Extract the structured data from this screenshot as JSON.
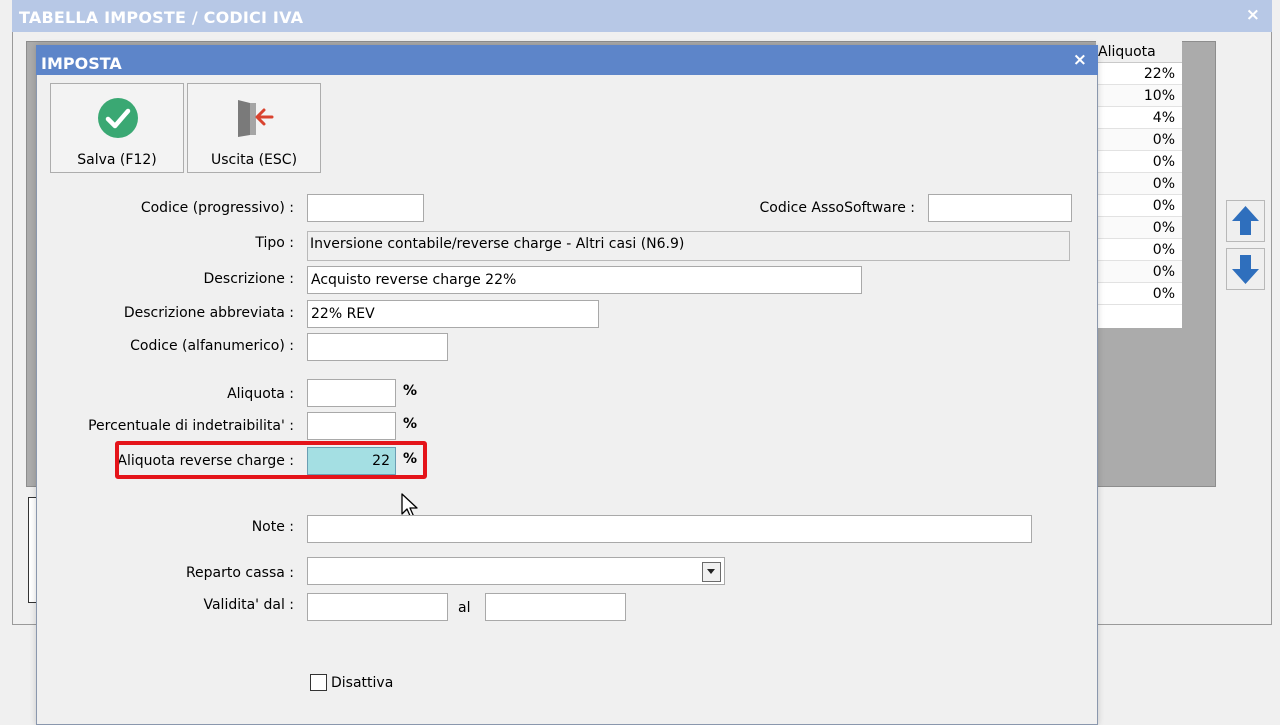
{
  "back_window": {
    "title": "TABELLA IMPOSTE / CODICI IVA",
    "close": "×",
    "grid": {
      "column_header": "Aliquota",
      "rows": [
        "22%",
        "10%",
        "4%",
        "0%",
        "0%",
        "0%",
        "0%",
        "0%",
        "0%",
        "0%",
        "0%"
      ]
    }
  },
  "dialog": {
    "title": "IMPOSTA",
    "close": "×",
    "toolbar": {
      "save_label": "Salva (F12)",
      "exit_label": "Uscita (ESC)"
    },
    "form": {
      "codice_progressivo": {
        "label": "Codice (progressivo) :",
        "value": ""
      },
      "codice_assosoftware": {
        "label": "Codice AssoSoftware :",
        "value": ""
      },
      "tipo": {
        "label": "Tipo :",
        "value": "Inversione contabile/reverse charge - Altri casi (N6.9)"
      },
      "descrizione": {
        "label": "Descrizione :",
        "value": "Acquisto reverse charge 22%"
      },
      "descrizione_abbreviata": {
        "label": "Descrizione abbreviata :",
        "value": "22% REV"
      },
      "codice_alfanumerico": {
        "label": "Codice (alfanumerico) :",
        "value": ""
      },
      "aliquota": {
        "label": "Aliquota :",
        "value": "",
        "unit": "%"
      },
      "percentuale_indetraibilita": {
        "label": "Percentuale di indetraibilita' :",
        "value": "",
        "unit": "%"
      },
      "aliquota_reverse_charge": {
        "label": "Aliquota reverse charge :",
        "value": "22",
        "unit": "%"
      },
      "note": {
        "label": "Note :",
        "value": ""
      },
      "reparto_cassa": {
        "label": "Reparto cassa :",
        "value": ""
      },
      "validita_dal": {
        "label": "Validita' dal :",
        "value": ""
      },
      "validita_al": {
        "label": "al",
        "value": ""
      },
      "disattiva": {
        "label": "Disattiva",
        "checked": false
      }
    }
  },
  "colors": {
    "dialog_title_bg": "#5d85c9",
    "back_title_bg": "#b7c8e6",
    "highlight": "#e4141a",
    "active_input_bg": "#a4dfe3",
    "save_icon": "#3aa873",
    "exit_arrow": "#d9432f",
    "arrow_buttons": "#2f6fbd"
  },
  "icons": {
    "save": "check-circle-icon",
    "exit": "door-exit-icon",
    "up": "arrow-up-icon",
    "down": "arrow-down-icon"
  }
}
